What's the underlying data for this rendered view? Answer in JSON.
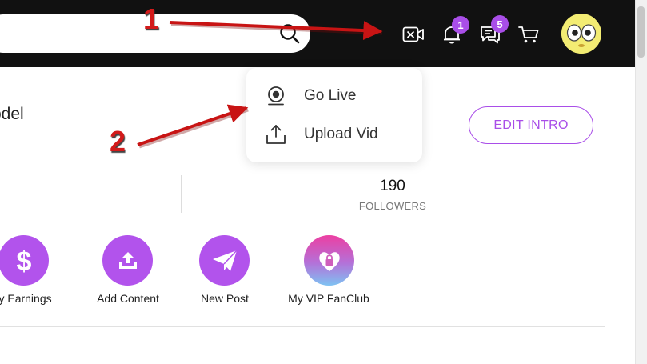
{
  "topbar": {
    "icons": {
      "search": "search-icon",
      "go_live": "video-off-icon",
      "notifications": "bell-icon",
      "messages": "chat-icon",
      "cart": "cart-icon"
    },
    "notification_count": "1",
    "message_count": "5",
    "avatar": "yellow-face-avatar"
  },
  "profile": {
    "name_partial": "odel",
    "edit_intro_label": "EDIT INTRO",
    "followers_count": "190",
    "followers_label": "FOLLOWERS"
  },
  "dropdown": {
    "items": [
      {
        "label": "Go Live",
        "icon": "webcam-icon"
      },
      {
        "label": "Upload Vid",
        "icon": "upload-icon"
      }
    ]
  },
  "actions": [
    {
      "label": "ly Earnings",
      "icon": "dollar-icon"
    },
    {
      "label": "Add Content",
      "icon": "upload-tray-icon"
    },
    {
      "label": "New Post",
      "icon": "paper-plane-icon"
    },
    {
      "label": "My VIP FanClub",
      "icon": "heart-lock-icon"
    }
  ],
  "annotations": [
    {
      "number": "1"
    },
    {
      "number": "2"
    }
  ],
  "colors": {
    "accent": "#a94ee8",
    "topbar": "#111111",
    "annotation": "#d21a1a"
  }
}
